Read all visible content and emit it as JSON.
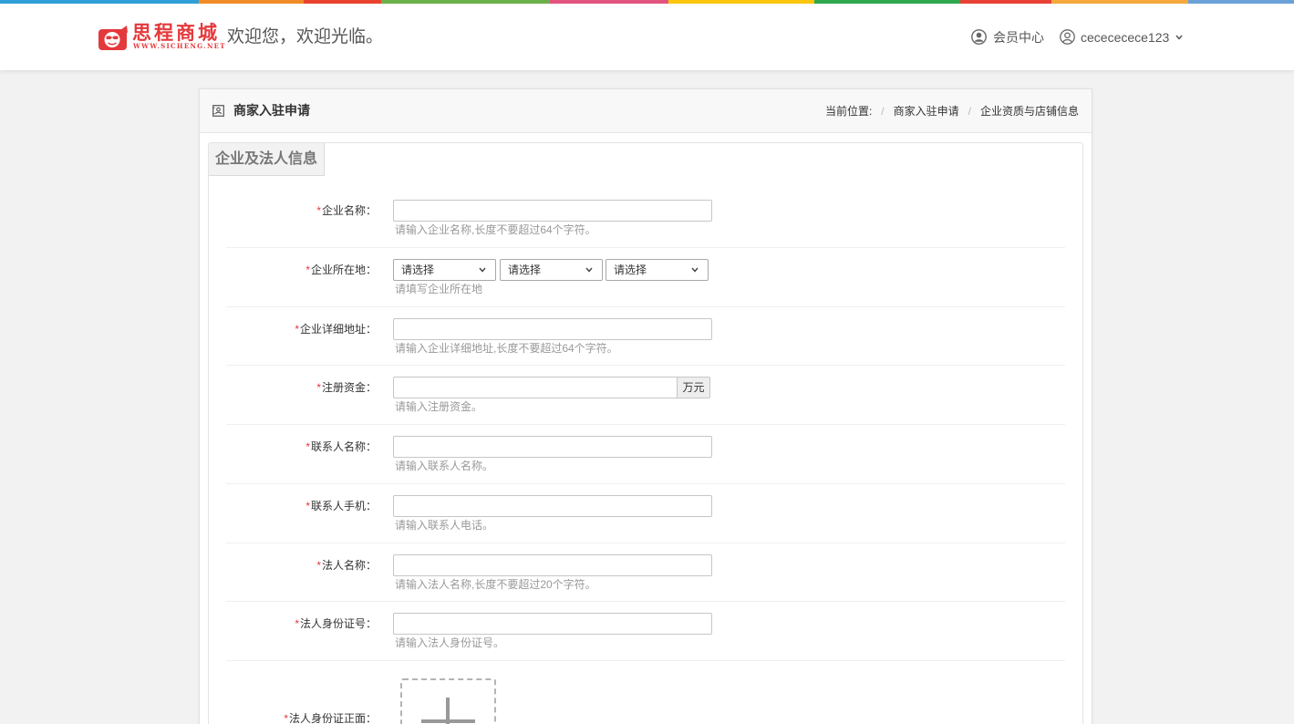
{
  "theme": {
    "brand_red": "#e4393c",
    "required_red": "#e4393c",
    "stripe_colors": [
      "#2f9fd8",
      "#f08c26",
      "#e8432e",
      "#6cb04a",
      "#e3537f",
      "#fcc60e",
      "#2fa84f",
      "#e84136",
      "#f6a93b",
      "#6aa1d8"
    ]
  },
  "icons": {
    "logo": "logo-mascot-icon",
    "member_center": "user-circle-icon",
    "user": "user-outline-icon",
    "user_menu": "chevron-down-icon",
    "panel_title": "id-card-icon",
    "select_arrow": "chevron-down-icon",
    "upload": "plus-icon"
  },
  "header": {
    "logo_text": "思程商城",
    "logo_subtext": "WWW.SICHENG.NET",
    "welcome": "欢迎您，欢迎光临。",
    "member_center": "会员中心",
    "username": "cecececece123"
  },
  "panel": {
    "title": "商家入驻申请",
    "breadcrumb": {
      "label": "当前位置:",
      "separator": "/",
      "items": [
        "商家入驻申请",
        "企业资质与店铺信息"
      ]
    }
  },
  "section": {
    "tab": "企业及法人信息"
  },
  "form": {
    "required_mark": "*",
    "company_name": {
      "label": "企业名称：",
      "value": "",
      "hint": "请输入企业名称,长度不要超过64个字符。"
    },
    "company_location": {
      "label": "企业所在地：",
      "selects": [
        "请选择",
        "请选择",
        "请选择"
      ],
      "hint": "请填写企业所在地"
    },
    "company_address": {
      "label": "企业详细地址：",
      "value": "",
      "hint": "请输入企业详细地址,长度不要超过64个字符。"
    },
    "registered_capital": {
      "label": "注册资金：",
      "value": "",
      "unit": "万元",
      "hint": "请输入注册资金。"
    },
    "contact_name": {
      "label": "联系人名称：",
      "value": "",
      "hint": "请输入联系人名称。"
    },
    "contact_phone": {
      "label": "联系人手机：",
      "value": "",
      "hint": "请输入联系人电话。"
    },
    "legal_name": {
      "label": "法人名称：",
      "value": "",
      "hint": "请输入法人名称,长度不要超过20个字符。"
    },
    "legal_id_number": {
      "label": "法人身份证号：",
      "value": "",
      "hint": "请输入法人身份证号。"
    },
    "legal_id_front": {
      "label": "法人身份证正面："
    }
  }
}
